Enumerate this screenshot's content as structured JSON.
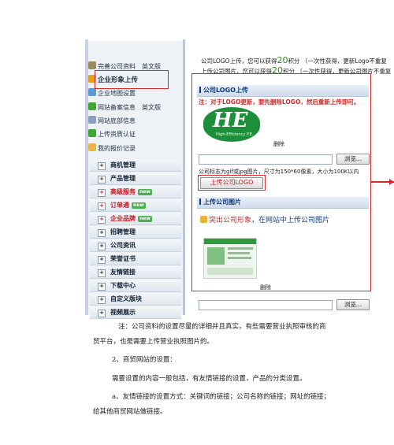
{
  "sidebar": {
    "top_items": [
      {
        "label": "完善公司资料",
        "extra": "英文版",
        "icon": "document-icon",
        "color": "#9b8a5a"
      },
      {
        "label": "企业形象上传",
        "extra": "",
        "icon": "image-icon",
        "color": "#e0a11b"
      },
      {
        "label": "企业地图设置",
        "extra": "",
        "icon": "map-icon",
        "color": "#5a9bd6"
      },
      {
        "label": "网站备案信息",
        "extra": "英文版",
        "icon": "leaf-icon",
        "color": "#3fa535"
      },
      {
        "label": "网站底部信息",
        "extra": "",
        "icon": "page-icon",
        "color": "#8aa0c0"
      },
      {
        "label": "上传资质认证",
        "extra": "",
        "icon": "leaf-icon",
        "color": "#3fa535"
      },
      {
        "label": "我的报价记录",
        "extra": "",
        "icon": "folder-icon",
        "color": "#e6b84a"
      }
    ],
    "sections": [
      {
        "label": "商机管理",
        "badge": "",
        "red": false
      },
      {
        "label": "产品管理",
        "badge": "",
        "red": false
      },
      {
        "label": "高级服务",
        "badge": "new",
        "red": true
      },
      {
        "label": "订单通",
        "badge": "new",
        "red": true
      },
      {
        "label": "企业品牌",
        "badge": "new",
        "red": true
      },
      {
        "label": "招聘管理",
        "badge": "",
        "red": false
      },
      {
        "label": "公司资讯",
        "badge": "",
        "red": false
      },
      {
        "label": "荣誉证书",
        "badge": "",
        "red": false
      },
      {
        "label": "友情链接",
        "badge": "",
        "red": false
      },
      {
        "label": "下载中心",
        "badge": "",
        "red": false
      },
      {
        "label": "自定义版块",
        "badge": "",
        "red": false
      },
      {
        "label": "视频展示",
        "badge": "",
        "red": false
      }
    ]
  },
  "notes": {
    "logo_line_pre": "公司LOGO上传，您可以获得",
    "logo_points": "20",
    "logo_line_post": "积分 （一次性获得，更新Logo不重复",
    "image_line_pre": "上传公司图片，您可以获得",
    "image_points": "20",
    "image_line_post": "积分 （一次性获得，更新公司图片不重复"
  },
  "logo_panel": {
    "title": "公司LOGO上传",
    "warning": "注：对于LOGO更新，要先删除LOGO，然后重新上传即可。",
    "logo_text": "HE",
    "logo_subtitle": "High-Efficiency P.E.",
    "delete_label": "删除",
    "browse_label": "浏览...",
    "hint": "公司标志为gif或jpg图片，尺寸为150*60像素，大小为100K以内",
    "upload_label": "上传公司LOGO"
  },
  "image_panel": {
    "title": "上传公司图片",
    "highlight_red": "突出公司形象",
    "highlight_blue": "，在网站中上传公司图片",
    "delete_label": "删除",
    "browse_label": "浏览..."
  },
  "body": {
    "para1_line1": "注：公司资料的设置尽量的详细并且真实，有些需要营业执照审核的商",
    "para1_line2": "贸平台，也是需要上传营业执照图片的。",
    "para2": "2、商贸网站的设置：",
    "para3": "需要设置的内容一般包括，有友情链接的设置，产品的分类设置。",
    "para4_line1": "a、友情链接的设置方式：关键词的链接；公司名称的链接；网址的链接；",
    "para4_line2": "给其他商贸网站做链接。"
  },
  "colors": {
    "red_frame": "#d02a2a",
    "accent_blue": "#0d3b78",
    "logo_green": "#1d8f3a"
  }
}
